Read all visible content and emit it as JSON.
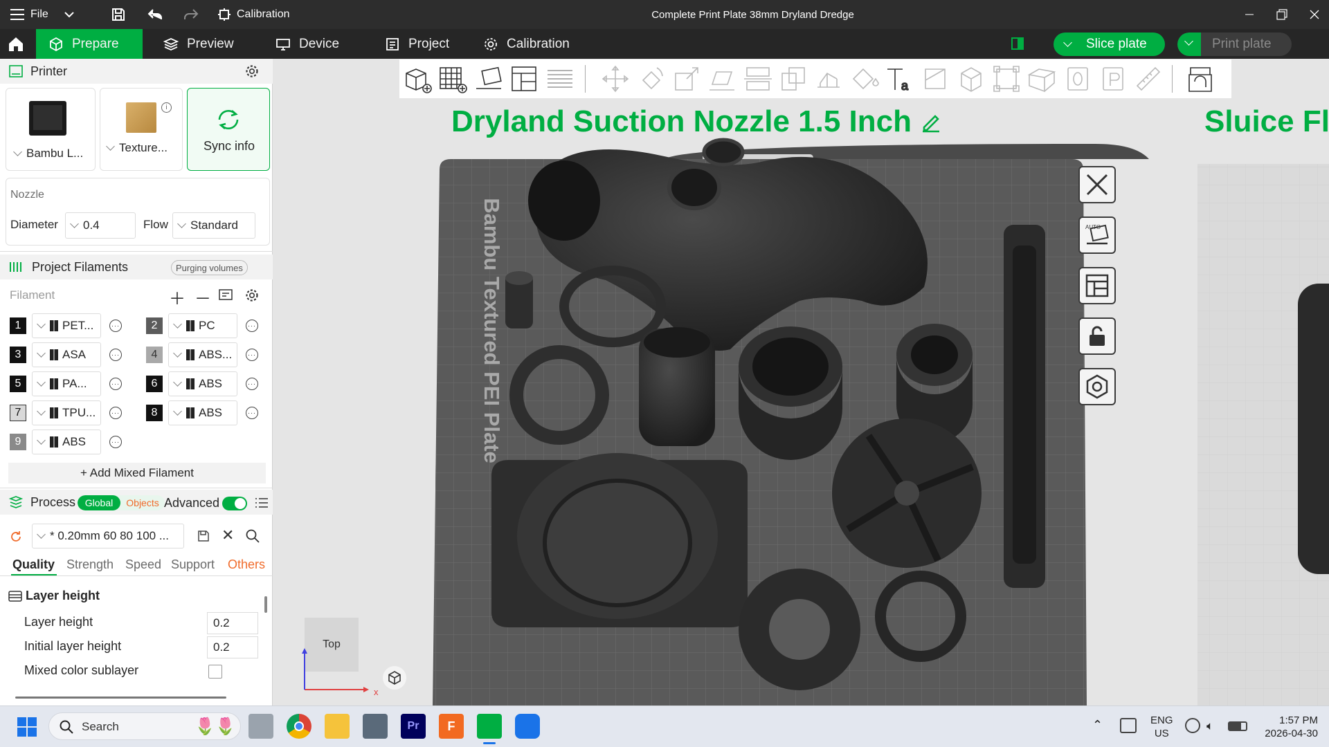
{
  "titlebar": {
    "file_label": "File",
    "calibration_label": "Calibration",
    "window_title": "Complete Print Plate 38mm Dryland Dredge"
  },
  "tabs": {
    "prepare": "Prepare",
    "preview": "Preview",
    "device": "Device",
    "project": "Project",
    "calibration": "Calibration"
  },
  "actions": {
    "slice_plate": "Slice plate",
    "print_plate": "Print plate"
  },
  "printer": {
    "section_title": "Printer",
    "printer_name": "Bambu L...",
    "plate_name": "Texture...",
    "sync_label": "Sync info",
    "nozzle_title": "Nozzle",
    "diameter_label": "Diameter",
    "diameter_value": "0.4",
    "flow_label": "Flow",
    "flow_value": "Standard"
  },
  "filaments": {
    "section_title": "Project Filaments",
    "purging_label": "Purging volumes",
    "filament_label": "Filament",
    "add_mixed_label": "+ Add Mixed Filament",
    "items": [
      {
        "num": "1",
        "name": "PET...",
        "color": "#111111",
        "text": "#ffffff"
      },
      {
        "num": "2",
        "name": "PC",
        "color": "#5c5c5c",
        "text": "#ffffff"
      },
      {
        "num": "3",
        "name": "ASA",
        "color": "#111111",
        "text": "#ffffff"
      },
      {
        "num": "4",
        "name": "ABS...",
        "color": "#a9a9a9",
        "text": "#333333"
      },
      {
        "num": "5",
        "name": "PA...",
        "color": "#111111",
        "text": "#ffffff"
      },
      {
        "num": "6",
        "name": "ABS",
        "color": "#111111",
        "text": "#ffffff"
      },
      {
        "num": "7",
        "name": "TPU...",
        "color": "#d9d9d9",
        "text": "#111111"
      },
      {
        "num": "8",
        "name": "ABS",
        "color": "#111111",
        "text": "#ffffff"
      },
      {
        "num": "9",
        "name": "ABS",
        "color": "#8a8a8a",
        "text": "#ffffff"
      }
    ]
  },
  "process": {
    "section_title": "Process",
    "global_label": "Global",
    "objects_label": "Objects",
    "advanced_label": "Advanced",
    "preset_value": "* 0.20mm 60 80 100 ...",
    "tabs": [
      "Quality",
      "Strength",
      "Speed",
      "Support",
      "Others"
    ],
    "group_title": "Layer height",
    "params": [
      {
        "label": "Layer height",
        "value": "0.2"
      },
      {
        "label": "Initial layer height",
        "value": "0.2"
      },
      {
        "label": "Mixed color sublayer",
        "value": ""
      }
    ]
  },
  "canvas": {
    "plate_title": "Dryland Suction Nozzle 1.5 Inch",
    "next_plate_title": "Sluice Fl",
    "plate_text": "Bambu Textured PEI Plate",
    "view_cube_label": "Top",
    "axis_x": "x",
    "title_color": "#00ae42"
  },
  "taskbar": {
    "search_label": "Search",
    "lang_top": "ENG",
    "lang_bottom": "US",
    "time": "1:57 PM",
    "date": "2026-04-30"
  },
  "colors": {
    "accent": "#00ae42",
    "titlebar": "#2d2d2d",
    "tabbar": "#262626",
    "others_tab": "#f06b2b"
  }
}
